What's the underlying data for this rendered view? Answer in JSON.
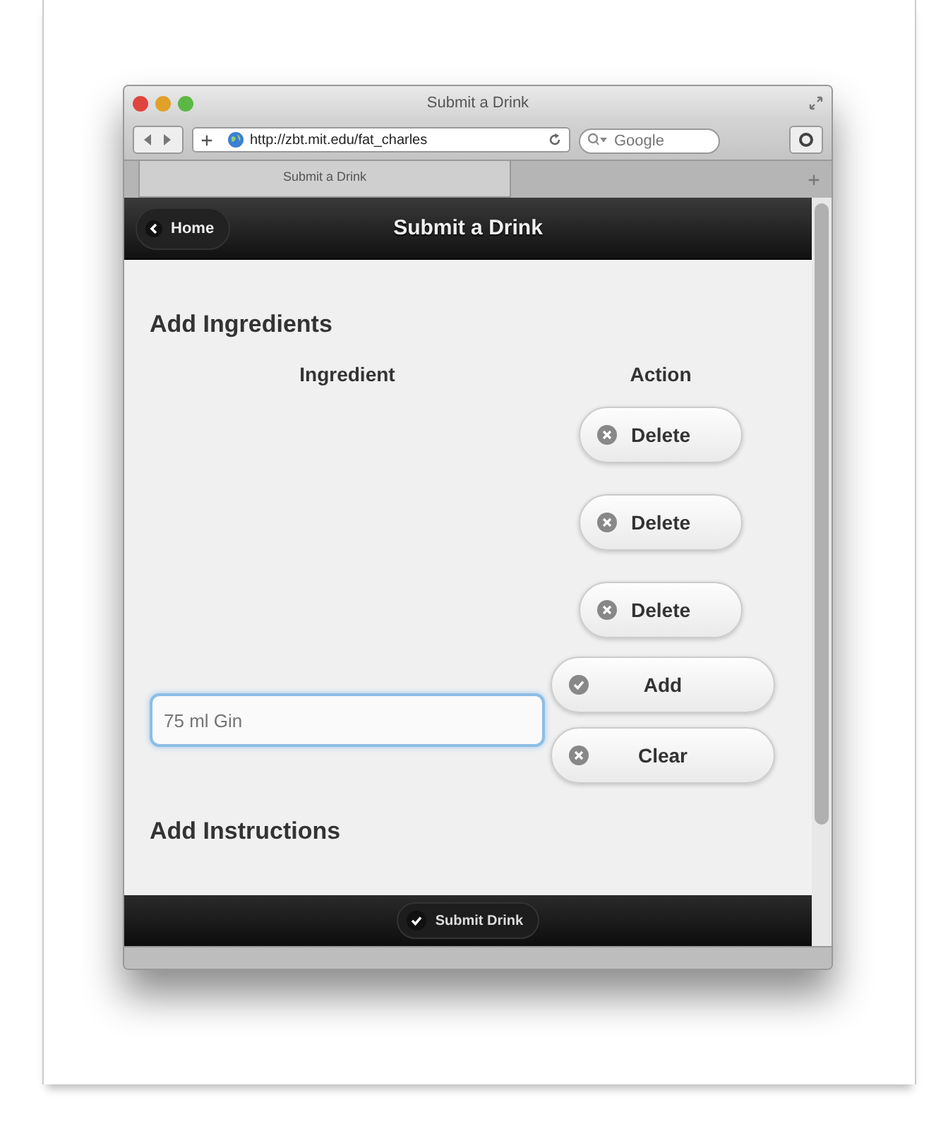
{
  "window": {
    "title": "Submit a Drink",
    "url": "http://zbt.mit.edu/fat_charles",
    "search_placeholder": "Google",
    "tab_title": "Submit a Drink"
  },
  "header": {
    "back_button": "Home",
    "title": "Submit a Drink"
  },
  "ingredients": {
    "heading": "Add Ingredients",
    "columns": [
      "Ingredient",
      "Action"
    ],
    "rows": [
      {
        "action": "Delete"
      },
      {
        "action": "Delete"
      },
      {
        "action": "Delete"
      }
    ],
    "input": {
      "placeholder": "75 ml Gin"
    },
    "buttons": [
      {
        "kind": "add",
        "label": "Add"
      },
      {
        "kind": "clear",
        "label": "Clear"
      }
    ]
  },
  "instructions": {
    "heading": "Add Instructions"
  },
  "footer": {
    "submit_button": "Submit Drink"
  }
}
